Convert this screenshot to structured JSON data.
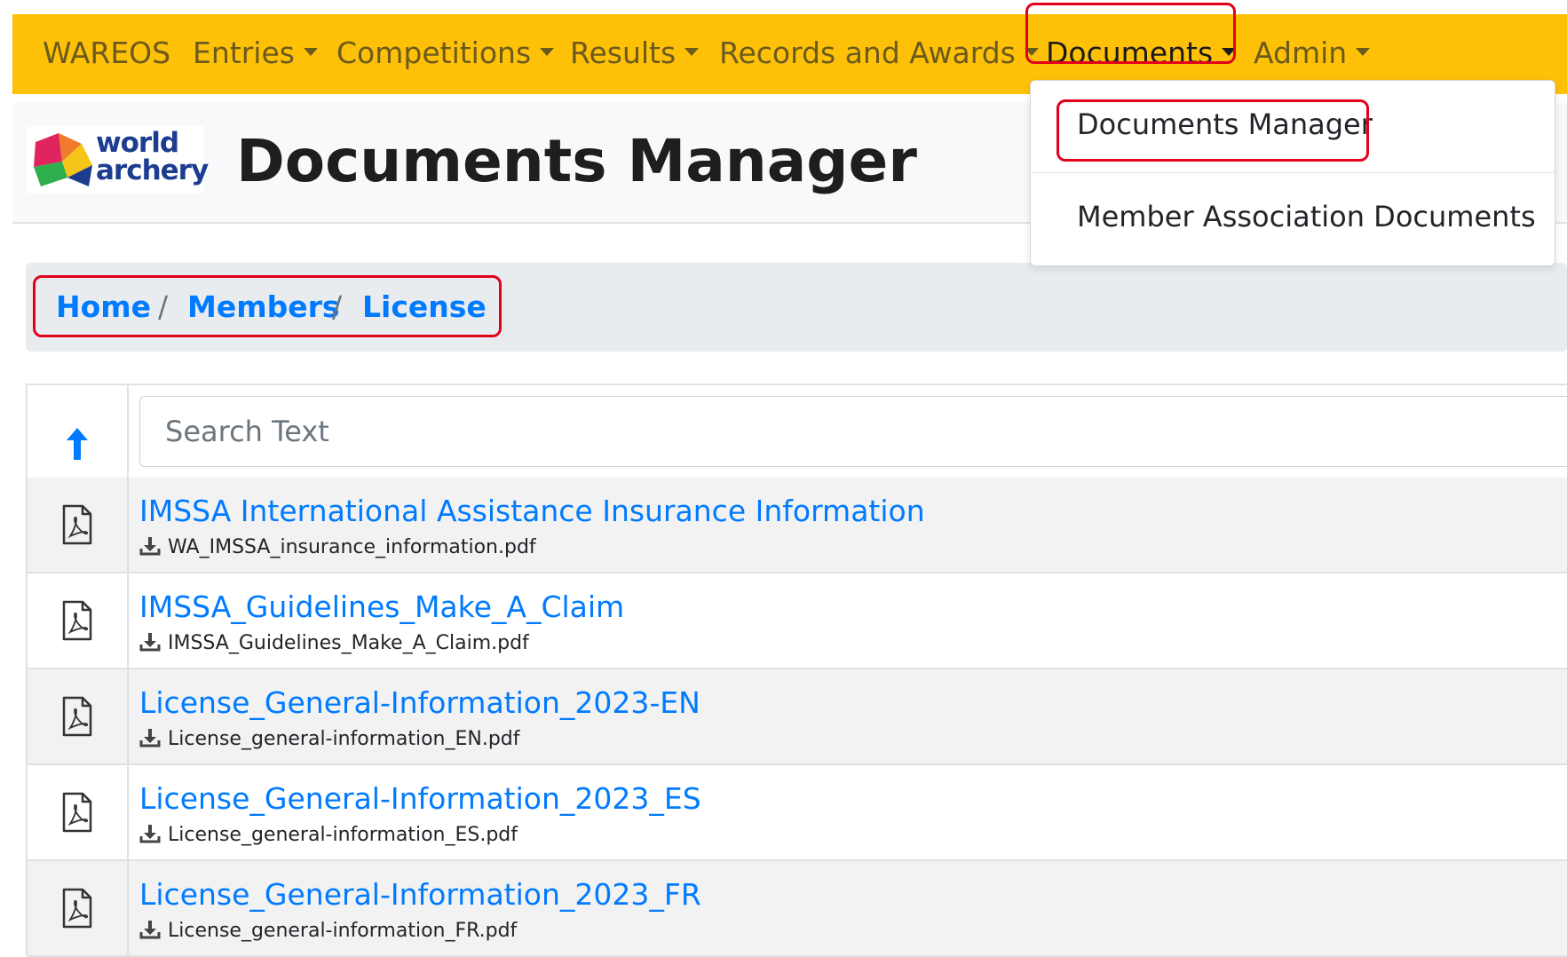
{
  "navbar": {
    "brand": "WAREOS",
    "items": [
      {
        "label": "Entries"
      },
      {
        "label": "Competitions"
      },
      {
        "label": "Results"
      },
      {
        "label": "Records and Awards"
      },
      {
        "label": "Documents"
      },
      {
        "label": "Admin"
      }
    ],
    "bg_color": "#ffc107"
  },
  "header": {
    "logo_line1": "world",
    "logo_line2": "archery",
    "title": "Documents Manager"
  },
  "dropdown": {
    "items": [
      "Documents Manager",
      "Member Association Documents"
    ]
  },
  "breadcrumb": [
    "Home",
    "Members",
    "License"
  ],
  "search": {
    "placeholder": "Search Text",
    "value": ""
  },
  "documents": [
    {
      "title": "IMSSA International Assistance Insurance Information",
      "file": "WA_IMSSA_insurance_information.pdf"
    },
    {
      "title": "IMSSA_Guidelines_Make_A_Claim",
      "file": "IMSSA_Guidelines_Make_A_Claim.pdf"
    },
    {
      "title": "License_General-Information_2023-EN",
      "file": "License_general-information_EN.pdf"
    },
    {
      "title": "License_General-Information_2023_ES",
      "file": "License_general-information_ES.pdf"
    },
    {
      "title": "License_General-Information_2023_FR",
      "file": "License_general-information_FR.pdf"
    }
  ],
  "icons": {
    "up": "arrow-up-icon",
    "pdf": "file-pdf-icon",
    "download": "download-icon",
    "caret": "caret-down-icon"
  },
  "colors": {
    "link": "#007bff",
    "highlight": "#e3001b"
  }
}
